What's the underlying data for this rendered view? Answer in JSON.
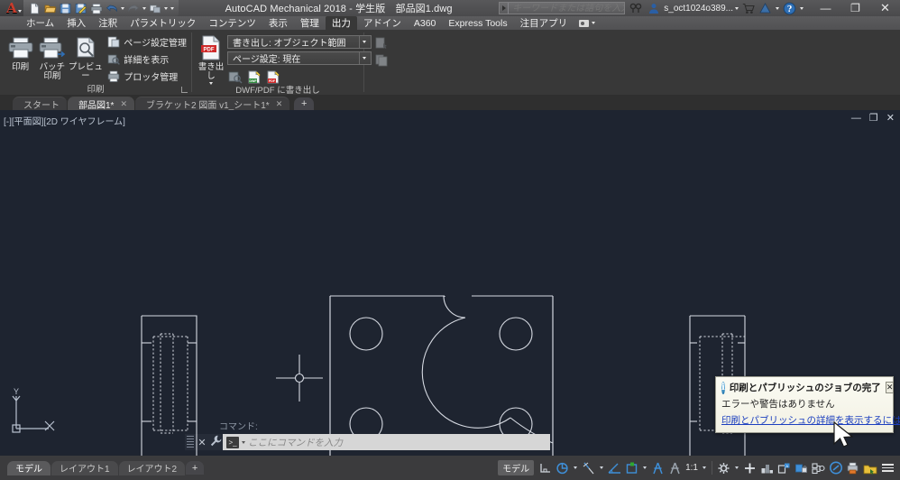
{
  "titlebar": {
    "app_title": "AutoCAD Mechanical 2018 - 学生版　部品図1.dwg",
    "logo_letter": "A",
    "qat_items": [
      {
        "name": "new-file-icon",
        "label": "新規作成"
      },
      {
        "name": "open-file-icon",
        "label": "開く"
      },
      {
        "name": "save-icon",
        "label": "保存"
      },
      {
        "name": "save-as-icon",
        "label": "名前を付けて保存"
      },
      {
        "name": "plot-icon",
        "label": "印刷"
      },
      {
        "name": "undo-icon",
        "label": "元に戻す"
      },
      {
        "name": "redo-icon",
        "label": "やり直し"
      },
      {
        "name": "workspace-icon",
        "label": "ワークスペース"
      }
    ],
    "search_placeholder": "キーワードまたは語句を入力",
    "user_name": "s_oct1024o389...",
    "icons": [
      "search-icon",
      "user-icon",
      "cart-icon",
      "help-center-icon",
      "question-icon"
    ],
    "window_buttons": {
      "minimize": "—",
      "restore": "❐",
      "close": "✕"
    }
  },
  "ribbon_tabs": {
    "items": [
      {
        "label": "ホーム",
        "active": false
      },
      {
        "label": "挿入",
        "active": false
      },
      {
        "label": "注釈",
        "active": false
      },
      {
        "label": "パラメトリック",
        "active": false
      },
      {
        "label": "コンテンツ",
        "active": false
      },
      {
        "label": "表示",
        "active": false
      },
      {
        "label": "管理",
        "active": false
      },
      {
        "label": "出力",
        "active": true
      },
      {
        "label": "アドイン",
        "active": false
      },
      {
        "label": "A360",
        "active": false
      },
      {
        "label": "Express Tools",
        "active": false
      },
      {
        "label": "注目アプリ",
        "active": false
      }
    ]
  },
  "ribbon": {
    "plot_panel": {
      "title": "印刷",
      "big_buttons": [
        {
          "label": "印刷",
          "icon": "printer-icon"
        },
        {
          "label": "バッチ\n印刷",
          "label_line1": "バッチ",
          "label_line2": "印刷",
          "icon": "batch-plot-icon"
        },
        {
          "label": "プレビュー",
          "icon": "preview-icon"
        }
      ],
      "small_items": [
        {
          "label": "ページ設定管理",
          "icon": "page-setup-icon"
        },
        {
          "label": "詳細を表示",
          "icon": "view-details-icon"
        },
        {
          "label": "プロッタ管理",
          "icon": "plotter-manager-icon"
        }
      ]
    },
    "export_panel": {
      "title": "DWF/PDF に書き出し",
      "big_button": {
        "label": "書き出し",
        "icon": "export-pdf-icon"
      },
      "combos": [
        {
          "value": "書き出し: オブジェクト範囲"
        },
        {
          "value": "ページ設定: 現在"
        }
      ],
      "icon_row": [
        "view-plot-icon",
        "export-dwf-icon",
        "export-pdf-small-icon"
      ],
      "ghost_icons": [
        "page-setup-ghost-icon",
        "page-setup-ghost2-icon"
      ]
    }
  },
  "file_tabs": {
    "items": [
      {
        "label": "スタート",
        "active": false,
        "closable": false
      },
      {
        "label": "部品図1*",
        "active": true,
        "closable": true
      },
      {
        "label": "ブラケット2 図面 v1_シート1*",
        "active": false,
        "closable": true
      }
    ],
    "add_label": "+",
    "close_glyph": "✕"
  },
  "canvas": {
    "viewport_label": "[-][平面図][2D ワイヤフレーム]",
    "window_buttons": {
      "minimize": "—",
      "restore": "❐",
      "close": "✕"
    },
    "ucs": {
      "x_label": "X",
      "y_label": "Y"
    },
    "background_color": "#1e2430",
    "line_color": "#d6dae2"
  },
  "command_line": {
    "history": "コマンド:",
    "placeholder": "ここにコマンドを入力",
    "close_glyph": "✕",
    "wrench_glyph": "🔧"
  },
  "notification": {
    "title": "印刷とパブリッシュのジョブの完了",
    "body": "エラーや警告はありません",
    "link": "印刷とパブリッシュの詳細を表示するにはここをクリック...",
    "close_glyph": "✕",
    "icon": "info-icon"
  },
  "statusbar": {
    "layout_tabs": [
      {
        "label": "モデル",
        "active": true
      },
      {
        "label": "レイアウト1",
        "active": false
      },
      {
        "label": "レイアウト2",
        "active": false
      }
    ],
    "add_label": "+",
    "model_chip": "モデル",
    "scale": "1:1",
    "right_icons": [
      "grid-display-icon",
      "snap-mode-icon",
      "ortho-mode-icon",
      "polar-tracking-icon",
      "object-snap-icon",
      "osnap-tracking-icon",
      "annotation-visibility-icon",
      "autoscale-icon",
      "workspace-switching-icon",
      "hardware-acceleration-icon",
      "isolate-objects-icon",
      "lock-ui-icon",
      "clean-screen-icon",
      "customization-icon"
    ]
  }
}
